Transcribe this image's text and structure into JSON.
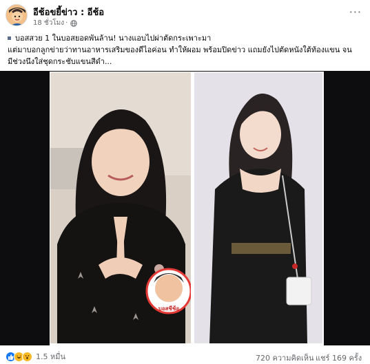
{
  "post": {
    "page_name": "อีช้อขยี้ข่าว : อีช้อ",
    "time": "18 ชั่วโมง",
    "separator": "·",
    "privacy_icon": "globe-icon",
    "more_icon": "more-options-icon",
    "more_label": "···",
    "caption": {
      "line1": "บอสสวย 1 ในบอสยอดพันล้าน! นางแอบไปผ่าตัดกระเพาะมา",
      "line2": "แต่มาบอกลูกข่ายว่าทานอาหารเสริมของดีไอค่อน ทำให้ผอม พร้อมปิดข่าว แถมยังไปตัดหนังใต้ท้องแขน จน",
      "line3": "มีช่วงนึงใส่ชุดกระชับแขนสีดำ..."
    }
  },
  "media": {
    "watermark_text": "บอสชีช้อ",
    "colors": {
      "backdrop": "#0d0d0f",
      "watermark_ring": "#e53935"
    }
  },
  "footer": {
    "reaction_icons": [
      "like-icon",
      "haha-icon",
      "wow-icon"
    ],
    "reaction_count": "1.5 หมื่น",
    "comment_count": "720 ความคิดเห็น",
    "share_count": "แชร์ 169 ครั้ง"
  }
}
